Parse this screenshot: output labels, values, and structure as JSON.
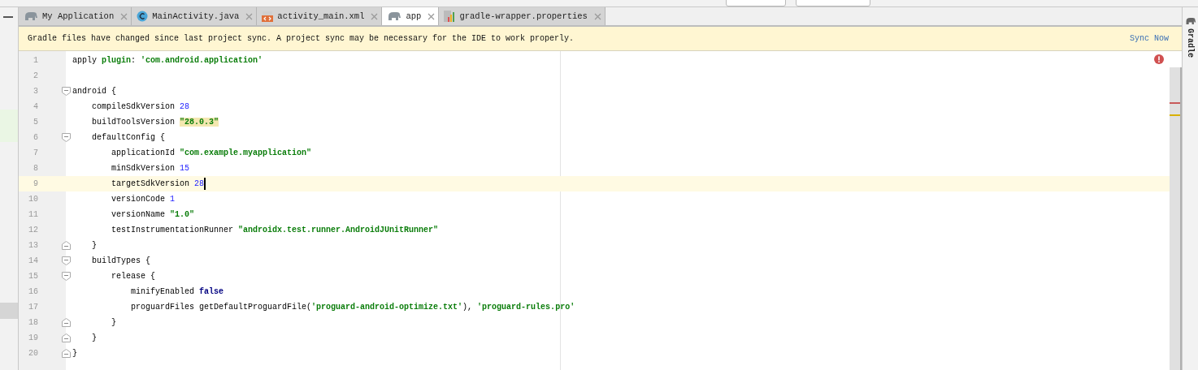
{
  "tabs": [
    {
      "label": "My Application",
      "kind": "gradle",
      "selected": false
    },
    {
      "label": "MainActivity.java",
      "kind": "class",
      "selected": false
    },
    {
      "label": "activity_main.xml",
      "kind": "layout",
      "selected": false
    },
    {
      "label": "app",
      "kind": "gradle",
      "selected": true
    },
    {
      "label": "gradle-wrapper.properties",
      "kind": "properties",
      "selected": false
    }
  ],
  "banner": {
    "message": "Gradle files have changed since last project sync. A project sync may be necessary for the IDE to work properly.",
    "action": "Sync Now"
  },
  "tool_window": {
    "label": "Gradle"
  },
  "editor": {
    "lines": [
      {
        "number": "1",
        "kind": "plain",
        "tokens": [
          {
            "kind": "plain",
            "text": "apply "
          },
          {
            "kind": "keyword",
            "text": "plugin"
          },
          {
            "kind": "plain",
            "text": ": "
          },
          {
            "kind": "string",
            "text": "'com.android.application'"
          }
        ]
      },
      {
        "number": "2",
        "kind": "plain"
      },
      {
        "number": "3",
        "kind": "block-start",
        "tokens": [
          {
            "kind": "plain",
            "text": "android {"
          }
        ]
      },
      {
        "number": "4",
        "kind": "plain",
        "tokens": [
          {
            "kind": "plain",
            "text": "    compileSdkVersion "
          },
          {
            "kind": "number",
            "text": "28"
          }
        ]
      },
      {
        "number": "5",
        "kind": "plain",
        "tokens": [
          {
            "kind": "plain",
            "text": "    buildToolsVersion "
          },
          {
            "kind": "string",
            "text": "\"28.0.3\"",
            "highlighted": true
          }
        ]
      },
      {
        "number": "6",
        "kind": "block-start",
        "tokens": [
          {
            "kind": "plain",
            "text": "    defaultConfig {"
          }
        ]
      },
      {
        "number": "7",
        "kind": "plain",
        "tokens": [
          {
            "kind": "plain",
            "text": "        applicationId "
          },
          {
            "kind": "string",
            "text": "\"com.example.myapplication\""
          }
        ]
      },
      {
        "number": "8",
        "kind": "plain",
        "tokens": [
          {
            "kind": "plain",
            "text": "        minSdkVersion "
          },
          {
            "kind": "number",
            "text": "15"
          }
        ]
      },
      {
        "number": "9",
        "kind": "plain",
        "current": true,
        "caret": true,
        "tokens": [
          {
            "kind": "plain",
            "text": "        targetSdkVersion "
          },
          {
            "kind": "number",
            "text": "28"
          }
        ]
      },
      {
        "number": "10",
        "kind": "plain",
        "tokens": [
          {
            "kind": "plain",
            "text": "        versionCode "
          },
          {
            "kind": "number",
            "text": "1"
          }
        ]
      },
      {
        "number": "11",
        "kind": "plain",
        "tokens": [
          {
            "kind": "plain",
            "text": "        versionName "
          },
          {
            "kind": "string",
            "text": "\"1.0\""
          }
        ]
      },
      {
        "number": "12",
        "kind": "plain",
        "tokens": [
          {
            "kind": "plain",
            "text": "        testInstrumentationRunner "
          },
          {
            "kind": "string",
            "text": "\"androidx.test.runner.AndroidJUnitRunner\""
          }
        ]
      },
      {
        "number": "13",
        "kind": "block-end",
        "tokens": [
          {
            "kind": "plain",
            "text": "    }"
          }
        ]
      },
      {
        "number": "14",
        "kind": "block-start",
        "tokens": [
          {
            "kind": "plain",
            "text": "    buildTypes {"
          }
        ]
      },
      {
        "number": "15",
        "kind": "block-start",
        "tokens": [
          {
            "kind": "plain",
            "text": "        release {"
          }
        ]
      },
      {
        "number": "16",
        "kind": "plain",
        "tokens": [
          {
            "kind": "plain",
            "text": "            minifyEnabled "
          },
          {
            "kind": "literal",
            "text": "false"
          }
        ]
      },
      {
        "number": "17",
        "kind": "plain",
        "tokens": [
          {
            "kind": "plain",
            "text": "            proguardFiles getDefaultProguardFile("
          },
          {
            "kind": "string",
            "text": "'proguard-android-optimize.txt'"
          },
          {
            "kind": "plain",
            "text": "), "
          },
          {
            "kind": "string",
            "text": "'proguard-rules.pro'"
          }
        ]
      },
      {
        "number": "18",
        "kind": "block-end",
        "tokens": [
          {
            "kind": "plain",
            "text": "        }"
          }
        ]
      },
      {
        "number": "19",
        "kind": "block-end",
        "tokens": [
          {
            "kind": "plain",
            "text": "    }"
          }
        ]
      },
      {
        "number": "20",
        "kind": "block-end",
        "tokens": [
          {
            "kind": "plain",
            "text": "}"
          }
        ]
      }
    ]
  }
}
